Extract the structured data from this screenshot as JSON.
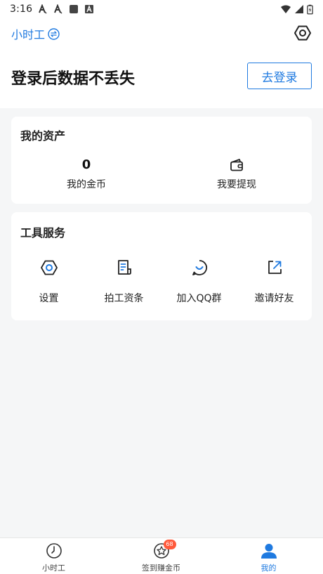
{
  "status_bar": {
    "time": "3:16"
  },
  "header": {
    "app_name": "小时工",
    "login_prompt": "登录后数据不丢失",
    "login_button": "去登录"
  },
  "assets": {
    "title": "我的资产",
    "coin_value": "0",
    "coin_label": "我的金币",
    "withdraw_label": "我要提现"
  },
  "tools": {
    "title": "工具服务",
    "items": [
      {
        "label": "设置",
        "icon": "settings-icon"
      },
      {
        "label": "拍工资条",
        "icon": "payslip-icon"
      },
      {
        "label": "加入QQ群",
        "icon": "qq-chat-icon"
      },
      {
        "label": "邀请好友",
        "icon": "share-icon"
      }
    ]
  },
  "tab_bar": {
    "items": [
      {
        "label": "小时工",
        "icon": "clock-icon"
      },
      {
        "label": "签到赚金币",
        "icon": "star-badge-icon",
        "badge": "68"
      },
      {
        "label": "我的",
        "icon": "user-icon"
      }
    ],
    "active_index": 2
  },
  "colors": {
    "accent": "#1f7ae0",
    "badge": "#ff5a3c",
    "background": "#f5f6f7"
  }
}
